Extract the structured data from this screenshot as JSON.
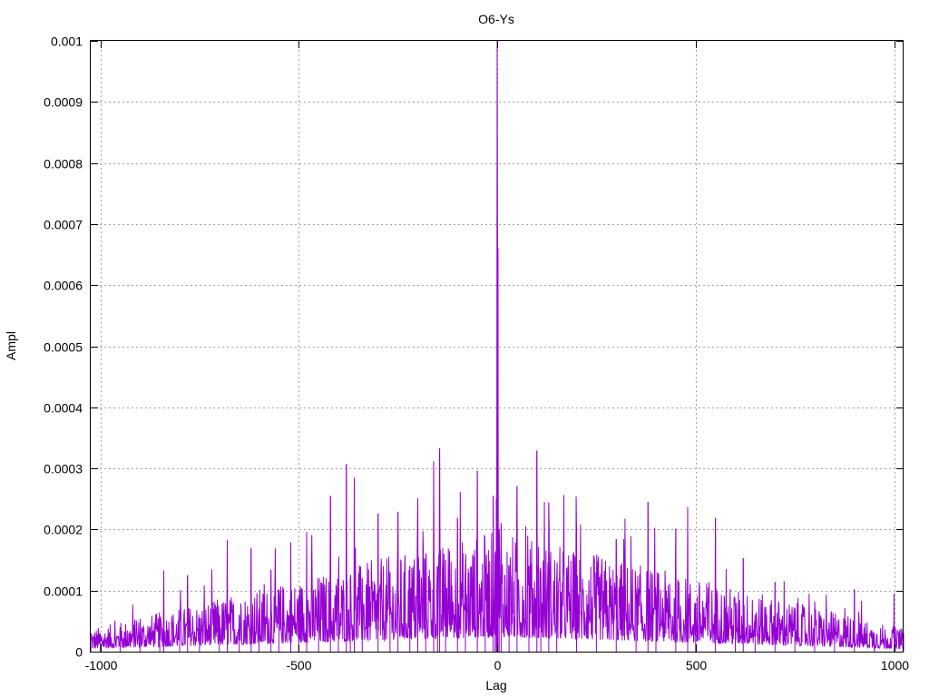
{
  "chart_data": {
    "type": "line",
    "title": "O6-Ys",
    "xlabel": "Lag",
    "ylabel": "Ampl",
    "xlim": [
      -1024,
      1024
    ],
    "ylim": [
      0,
      0.001
    ],
    "x_ticks": [
      "-1000",
      "-500",
      "0",
      "500",
      "1000"
    ],
    "x_tick_values": [
      -1000,
      -500,
      0,
      500,
      1000
    ],
    "y_ticks": [
      "0",
      "0.0001",
      "0.0002",
      "0.0003",
      "0.0004",
      "0.0005",
      "0.0006",
      "0.0007",
      "0.0008",
      "0.0009",
      "0.001"
    ],
    "y_tick_values": [
      0,
      0.0001,
      0.0002,
      0.0003,
      0.0004,
      0.0005,
      0.0006,
      0.0007,
      0.0008,
      0.0009,
      0.001
    ],
    "grid": true,
    "series_color": "#9400d3",
    "series": [
      {
        "x": [
          -1024,
          -1000,
          -950,
          -900,
          -850,
          -840,
          -800,
          -780,
          -750,
          -700,
          -680,
          -650,
          -620,
          -600,
          -570,
          -550,
          -520,
          -500,
          -480,
          -450,
          -420,
          -400,
          -380,
          -370,
          -360,
          -340,
          -300,
          -270,
          -250,
          -220,
          -200,
          -180,
          -160,
          -150,
          -145,
          -130,
          -100,
          -80,
          -50,
          -30,
          -10,
          -5,
          -2,
          0,
          2,
          5,
          10,
          30,
          50,
          80,
          100,
          110,
          130,
          150,
          200,
          250,
          300,
          350,
          380,
          400,
          450,
          480,
          500,
          550,
          600,
          620,
          650,
          700,
          750,
          800,
          850,
          900,
          950,
          1000,
          1024
        ],
        "y": [
          3e-05,
          3e-05,
          4e-05,
          3e-05,
          4e-05,
          0.000133,
          5e-05,
          0.000125,
          5e-05,
          6e-05,
          0.000183,
          6e-05,
          0.000169,
          7e-05,
          0.000134,
          8e-05,
          0.000179,
          9e-05,
          0.000196,
          0.0001,
          0.000255,
          0.00011,
          0.000307,
          0.00012,
          0.000285,
          0.00012,
          0.000226,
          0.00013,
          0.000229,
          0.00014,
          0.000251,
          0.00015,
          0.000312,
          0.00014,
          0.000333,
          0.00015,
          0.000219,
          0.00014,
          0.000296,
          0.00014,
          0.000255,
          0.00016,
          0.00025,
          0.001,
          0.00066,
          0.0002,
          0.00021,
          0.00014,
          0.000271,
          0.00014,
          0.000329,
          0.00013,
          0.000244,
          0.00012,
          0.0002,
          0.00011,
          0.000184,
          0.0001,
          0.000245,
          9e-05,
          0.000201,
          0.000237,
          8e-05,
          0.000219,
          7e-05,
          0.000153,
          6e-05,
          0.000114,
          5e-05,
          8.2e-05,
          4e-05,
          0.000102,
          3e-05,
          9.5e-05,
          3e-05
        ]
      }
    ]
  }
}
